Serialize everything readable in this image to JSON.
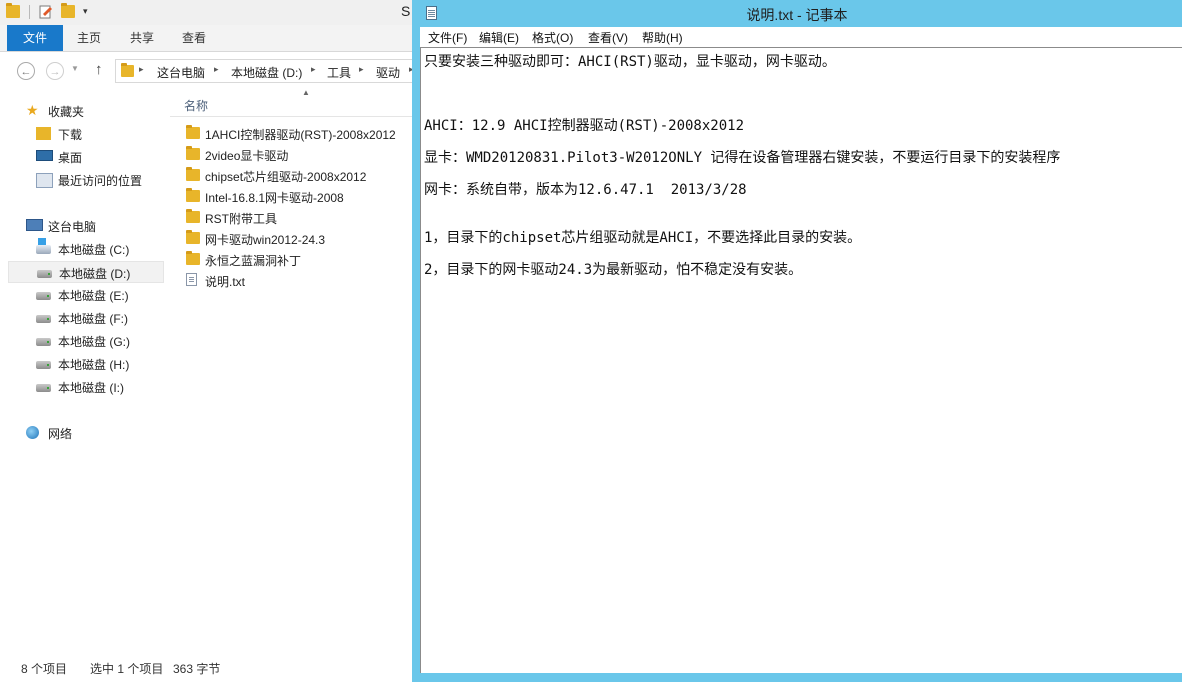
{
  "explorer": {
    "title_fragment": "S",
    "ribbon_tabs": [
      {
        "label": "文件"
      },
      {
        "label": "主页"
      },
      {
        "label": "共享"
      },
      {
        "label": "查看"
      }
    ],
    "quick_access_dropdown": "▾",
    "address": {
      "crumbs": [
        "这台电脑",
        "本地磁盘 (D:)",
        "工具",
        "驱动"
      ],
      "separator": "▸"
    },
    "nav": {
      "favorites": "收藏夹",
      "downloads": "下载",
      "desktop": "桌面",
      "recent": "最近访问的位置",
      "this_pc": "这台电脑",
      "drives": [
        "本地磁盘 (C:)",
        "本地磁盘 (D:)",
        "本地磁盘 (E:)",
        "本地磁盘 (F:)",
        "本地磁盘 (G:)",
        "本地磁盘 (H:)",
        "本地磁盘 (I:)"
      ],
      "network": "网络",
      "selected_drive_index": 1
    },
    "file_list": {
      "column_name": "名称",
      "items": [
        {
          "name": "1AHCI控制器驱动(RST)-2008x2012",
          "type": "folder"
        },
        {
          "name": "2video显卡驱动",
          "type": "folder"
        },
        {
          "name": "chipset芯片组驱动-2008x2012",
          "type": "folder"
        },
        {
          "name": "Intel-16.8.1网卡驱动-2008",
          "type": "folder"
        },
        {
          "name": "RST附带工具",
          "type": "folder"
        },
        {
          "name": "网卡驱动win2012-24.3",
          "type": "folder"
        },
        {
          "name": "永恒之蓝漏洞补丁",
          "type": "folder"
        },
        {
          "name": "说明.txt",
          "type": "txt"
        }
      ]
    },
    "status": {
      "count": "8 个项目",
      "selection": "选中 1 个项目",
      "size": "363 字节"
    }
  },
  "notepad": {
    "title": "说明.txt - 记事本",
    "menu": [
      "文件(F)",
      "编辑(E)",
      "格式(O)",
      "查看(V)",
      "帮助(H)"
    ],
    "lines": [
      "只要安装三种驱动即可：AHCI(RST)驱动，显卡驱动，网卡驱动。",
      "",
      "",
      "AHCI：12.9 AHCI控制器驱动(RST)-2008x2012",
      "显卡：WMD20120831.Pilot3-W2012ONLY 记得在设备管理器右键安装，不要运行目录下的安装程序",
      "网卡：系统自带，版本为12.6.47.1  2013/3/28",
      "",
      "1，目录下的chipset芯片组驱动就是AHCI，不要选择此目录的安装。",
      "2，目录下的网卡驱动24.3为最新驱动，怕不稳定没有安装。"
    ]
  },
  "colors": {
    "notepad_frame": "#6ac7ea",
    "ribbon_file_tab": "#1979ca"
  }
}
